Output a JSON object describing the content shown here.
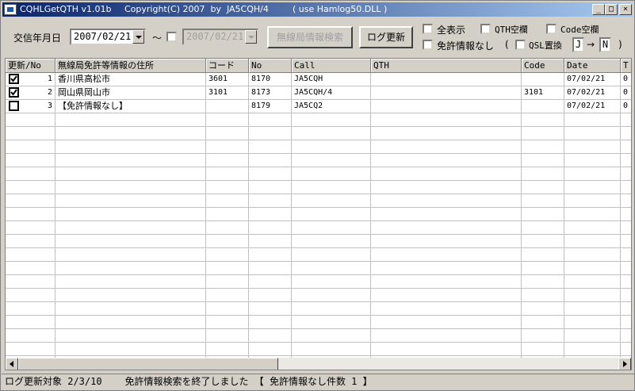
{
  "titlebar": {
    "app_name": "CQHLGetQTH v1.01b",
    "copyright": "Copyright(C) 2007  by  JA5CQH/4",
    "dll": "( use Hamlog50.DLL )",
    "min_symbol": "_",
    "max_symbol": "□",
    "close_symbol": "×"
  },
  "controls": {
    "date_label": "交信年月日",
    "date_from": "2007/02/21",
    "tilde": "〜",
    "date_to": "2007/02/21",
    "search_button": "無線局情報検索",
    "update_button": "ログ更新",
    "show_all": "全表示",
    "qth_blank": "QTH空欄",
    "code_blank": "Code空欄",
    "no_license": "免許情報なし",
    "paren_open": "(",
    "qsl_replace": "QSL置換",
    "qsl_from": "J",
    "arrow": "→",
    "qsl_to": "N",
    "paren_close": ")"
  },
  "grid": {
    "columns": [
      "更新/No",
      "無線局免許等情報の住所",
      "コード",
      "No",
      "Call",
      "QTH",
      "Code",
      "Date",
      "T"
    ],
    "rows": [
      {
        "checked": true,
        "no": "1",
        "address": "香川県高松市",
        "code": "3601",
        "num": "8170",
        "call": "JA5CQH",
        "qth": "",
        "qcode": "",
        "date": "07/02/21",
        "t": "0"
      },
      {
        "checked": true,
        "no": "2",
        "address": "岡山県岡山市",
        "code": "3101",
        "num": "8173",
        "call": "JA5CQH/4",
        "qth": "",
        "qcode": "3101",
        "date": "07/02/21",
        "t": "0"
      },
      {
        "checked": false,
        "no": "3",
        "address": "【免許情報なし】",
        "code": "",
        "num": "8179",
        "call": "JA5CQ2",
        "qth": "",
        "qcode": "",
        "date": "07/02/21",
        "t": "0"
      }
    ]
  },
  "status": {
    "target": "ログ更新対象 2/3/10",
    "message": "免許情報検索を終了しました",
    "result": "【 免許情報なし件数 1 】"
  }
}
